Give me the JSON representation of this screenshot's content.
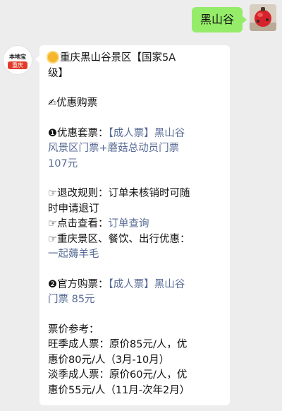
{
  "chat": {
    "outgoing": {
      "text": "黑山谷"
    },
    "incoming": {
      "bot_avatar": {
        "brand": "本地宝",
        "tag": "重庆"
      },
      "title_a": "重庆黑山谷景区【国家5A",
      "title_b": "级】",
      "section_title": "✍优惠购票",
      "offer1_prefix": "❶优惠套票：",
      "offer1_link_a": "【成人票】黑山谷",
      "offer1_link_b": "风景区门票+蘑菇总动员门票",
      "offer1_price": "107元",
      "refund_a": "☞退改规则：订单未核销时可随",
      "refund_b": "时申请退订",
      "check_prefix": "☞点击查看：",
      "check_link": "订单查询",
      "benefit": "☞重庆景区、餐饮、出行优惠：",
      "benefit_link": "一起薅羊毛",
      "offer2_prefix": "❷官方购票：",
      "offer2_link_a": "【成人票】黑山谷",
      "offer2_link_b": "门票 85元",
      "price_ref": "票价参考：",
      "peak_a": "旺季成人票：原价85元/人，优",
      "peak_b": "惠价80元/人（3月-10月）",
      "low_a": "淡季成人票：原价60元/人，优",
      "low_b": "惠价55元/人（11月-次年2月）"
    }
  },
  "colors": {
    "outgoing_bubble": "#95ec69",
    "link": "#576b95",
    "background": "#ededed"
  }
}
